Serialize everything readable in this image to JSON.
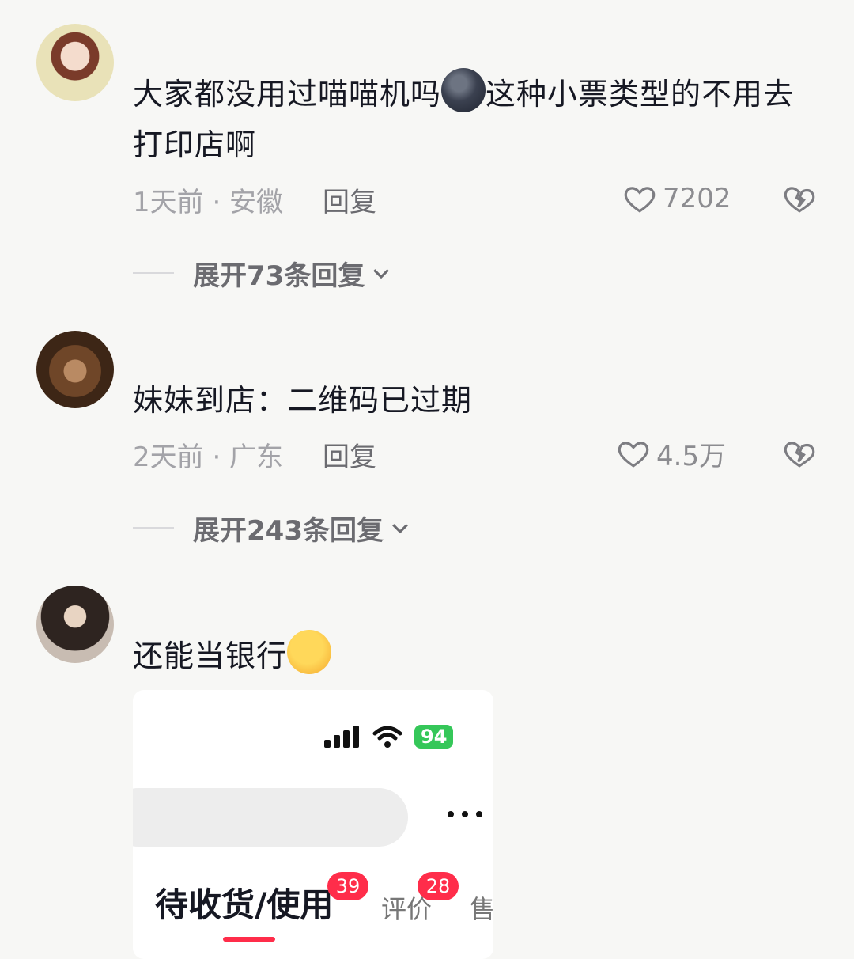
{
  "comments": [
    {
      "text_before": "大家都没用过喵喵机吗",
      "emoji": "new-moon-face-emoji",
      "text_after": "这种小票类型的不用去打印店啊",
      "time_location": "1天前 · 安徽",
      "reply": "回复",
      "likes": "7202",
      "expand": "展开73条回复"
    },
    {
      "text": "妹妹到店：二维码已过期",
      "time_location": "2天前 · 广东",
      "reply": "回复",
      "likes": "4.5万",
      "expand": "展开243条回复"
    },
    {
      "text": "还能当银行",
      "emoji": "angry-face-emoji",
      "screenshot": {
        "battery": "94",
        "tab_main": "待收货/使用",
        "tab_main_badge": "39",
        "tab_review": "评价",
        "tab_review_badge": "28",
        "tab_sale": "售"
      }
    }
  ],
  "colors": {
    "background": "#f7f7f5",
    "text_primary": "#161823",
    "text_secondary": "#a3a3a8",
    "badge_red": "#ff2d4a",
    "battery_green": "#35c759"
  }
}
